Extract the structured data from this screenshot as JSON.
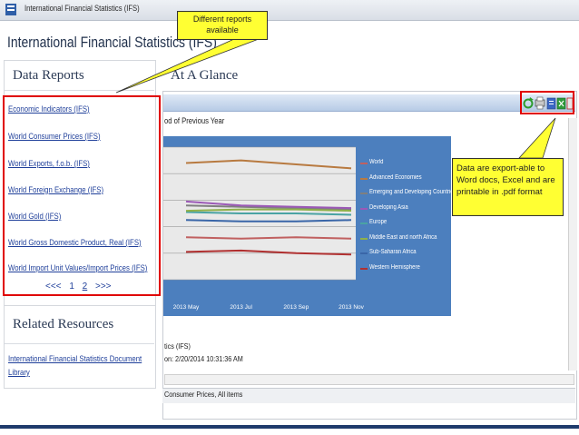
{
  "window": {
    "breadcrumb": "International Financial Statistics (IFS)"
  },
  "page": {
    "title": "International Financial Statistics (IFS)"
  },
  "data_reports": {
    "heading": "Data Reports",
    "items": [
      "Economic Indicators (IFS)",
      "World Consumer Prices (IFS)",
      "World Exports, f.o.b. (IFS)",
      "World Foreign Exchange (IFS)",
      "World Gold (IFS)",
      "World Gross Domestic Product, Real (IFS)",
      "World Import Unit Values/Import Prices (IFS)"
    ],
    "pager": {
      "first": "<<<",
      "page1": "1",
      "page2": "2",
      "next": ">>>"
    }
  },
  "related": {
    "heading": "Related Resources",
    "link": "International Financial Statistics Document Library"
  },
  "glance": {
    "heading": "At A Glance",
    "chart_title": "od of Previous Year",
    "footer_source": "tics (IFS)",
    "footer_date": "on: 2/20/2014 10:31:36 AM"
  },
  "tabs": {
    "active": "Consumer Prices, All items"
  },
  "callouts": {
    "reports": "Different reports available",
    "export": "Data are export-able to Word docs, Excel and are printable in .pdf format"
  },
  "colors": {
    "highlight": "#ffff33",
    "annotation_red": "#e00000",
    "chart_plot_bg": "#4c7fbe",
    "link": "#1f3f9a"
  },
  "chart_data": {
    "type": "line",
    "title": "",
    "categories": [
      "2013 May",
      "2013 Jul",
      "2013 Sep",
      "2013 Nov"
    ],
    "series": [
      {
        "name": "World",
        "color": "#c06060",
        "values": [
          3.2,
          3.1,
          3.2,
          3.1
        ]
      },
      {
        "name": "Advanced Economies",
        "color": "#b87a40",
        "values": [
          8.8,
          9.0,
          8.7,
          8.4
        ]
      },
      {
        "name": "Emerging and Developing Countries",
        "color": "#7f7f7f",
        "values": [
          5.6,
          5.5,
          5.4,
          5.3
        ]
      },
      {
        "name": "Developing Asia",
        "color": "#9b59b6",
        "values": [
          5.9,
          5.6,
          5.5,
          5.4
        ]
      },
      {
        "name": "Europe",
        "color": "#4aa3a3",
        "values": [
          5.1,
          5.0,
          5.0,
          4.9
        ]
      },
      {
        "name": "Middle East and north Africa",
        "color": "#8fb04a",
        "values": [
          5.2,
          5.3,
          5.3,
          5.2
        ]
      },
      {
        "name": "Sub-Saharan Africa",
        "color": "#3a66a8",
        "values": [
          4.5,
          4.4,
          4.4,
          4.5
        ]
      },
      {
        "name": "Western Hemisphere",
        "color": "#b03030",
        "values": [
          2.1,
          2.2,
          2.0,
          1.9
        ]
      }
    ],
    "ylim": [
      0,
      10
    ],
    "grid": true,
    "legend": "right"
  }
}
